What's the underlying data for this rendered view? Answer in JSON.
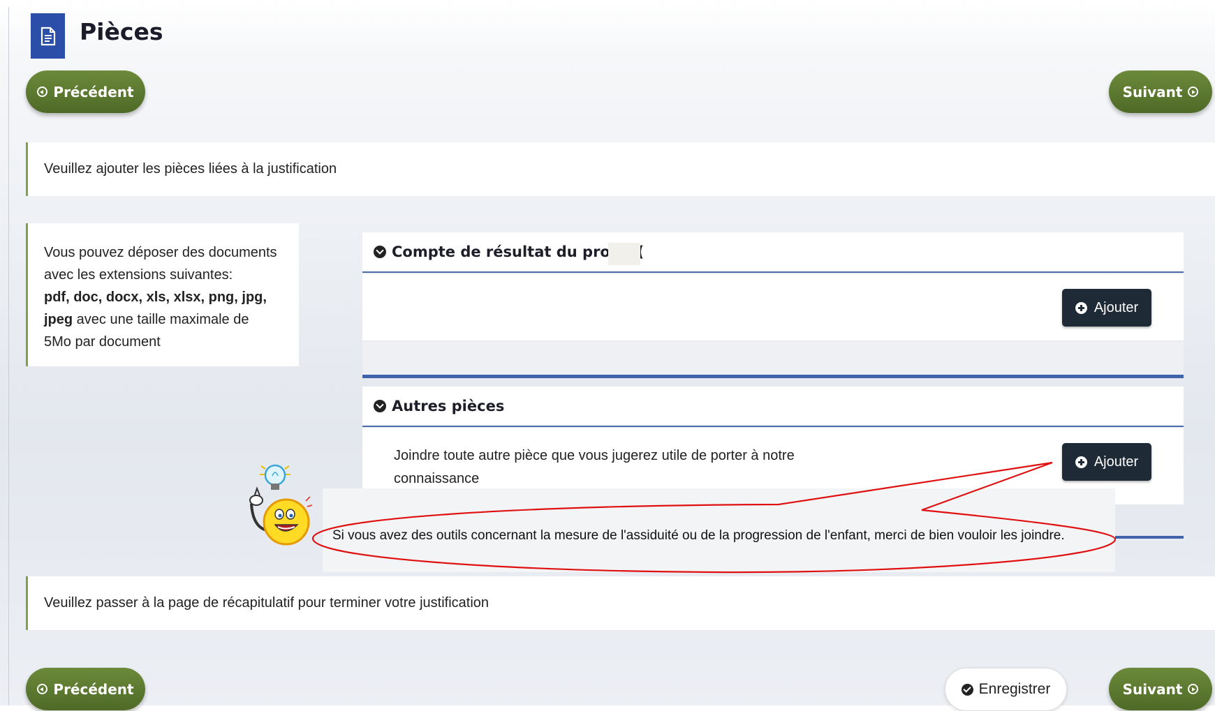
{
  "header": {
    "title": "Pièces",
    "icon": "document-icon"
  },
  "nav": {
    "prev_label": "Précédent",
    "next_label": "Suivant",
    "save_label": "Enregistrer"
  },
  "intro": "Veuillez ajouter les pièces liées à la justification",
  "extensions_note": {
    "line1": "Vous pouvez déposer des documents",
    "line2": "avec les extensions suivantes:",
    "ext_a": "pdf, doc, docx, xls, xlsx, png, jpg,",
    "ext_b": "jpeg",
    "tail_a": " avec une taille maximale de",
    "line5": "5Mo par document"
  },
  "sections": [
    {
      "title": "Compte de résultat du projet (",
      "add_label": "Ajouter"
    },
    {
      "title": "Autres pièces",
      "description_line1": "Joindre toute autre pièce que vous jugerez utile de porter à notre",
      "description_line2": "connaissance",
      "add_label": "Ajouter"
    }
  ],
  "callout": {
    "text": "Si vous avez des outils concernant la mesure de l'assiduité ou de la progression de l'enfant, merci de bien vouloir les joindre."
  },
  "footer_note": "Veuillez passer à la page de récapitulatif pour terminer votre justification",
  "colors": {
    "accent_green": "#5a7a2e",
    "brand_blue": "#2b4fa8",
    "dark_button": "#1e2a36",
    "callout_red": "#e01010"
  }
}
